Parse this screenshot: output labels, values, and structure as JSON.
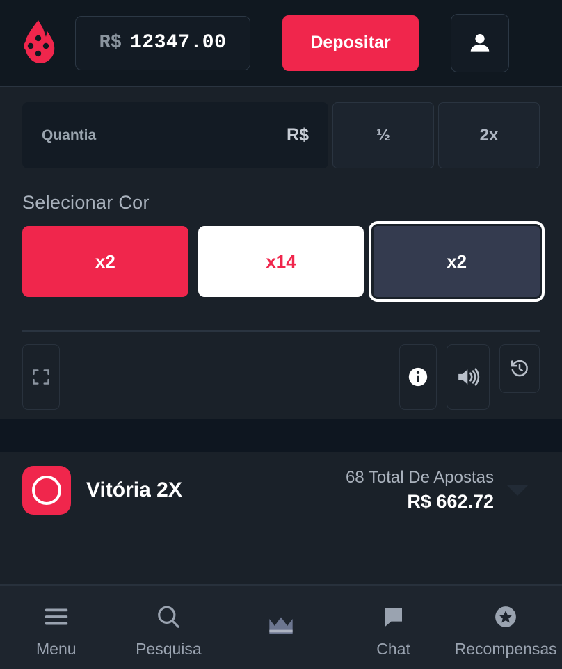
{
  "topbar": {
    "logo_icon": "flame-dice-logo",
    "balance": {
      "currency": "R$",
      "value": "12347.00"
    },
    "deposit_label": "Depositar",
    "avatar_icon": "person-icon"
  },
  "bet": {
    "amount_placeholder": "Quantia",
    "amount_value": "",
    "amount_currency": "R$",
    "half_label": "½",
    "double_label": "2x",
    "section_title": "Selecionar Cor",
    "colors": [
      {
        "name": "red",
        "label": "x2",
        "hex": "#f0264c",
        "selected": false
      },
      {
        "name": "white",
        "label": "x14",
        "hex": "#ffffff",
        "selected": false
      },
      {
        "name": "black",
        "label": "x2",
        "hex": "#343b4f",
        "selected": true
      }
    ]
  },
  "controls": {
    "fullscreen_icon": "fullscreen-icon",
    "info_icon": "info-icon",
    "volume_icon": "volume-on-icon",
    "history_icon": "history-icon"
  },
  "result": {
    "badge_icon": "circle-outline-icon",
    "victory_label": "Vitória 2X",
    "bets_count": "68 Total De Apostas",
    "bets_total": "R$ 662.72",
    "expand_icon": "chevron-down-icon"
  },
  "bottom_nav": [
    {
      "label": "Menu",
      "icon": "hamburger-menu-icon"
    },
    {
      "label": "Pesquisa",
      "icon": "search-icon"
    },
    {
      "label": "",
      "icon": "crown-icon"
    },
    {
      "label": "Chat",
      "icon": "chat-bubble-icon"
    },
    {
      "label": "Recompensas",
      "icon": "star-circle-icon"
    }
  ],
  "theme": {
    "accent": "#f0264c",
    "bg": "#1a2129",
    "bg_dark": "#101820",
    "text_muted": "#9aa3b0"
  }
}
